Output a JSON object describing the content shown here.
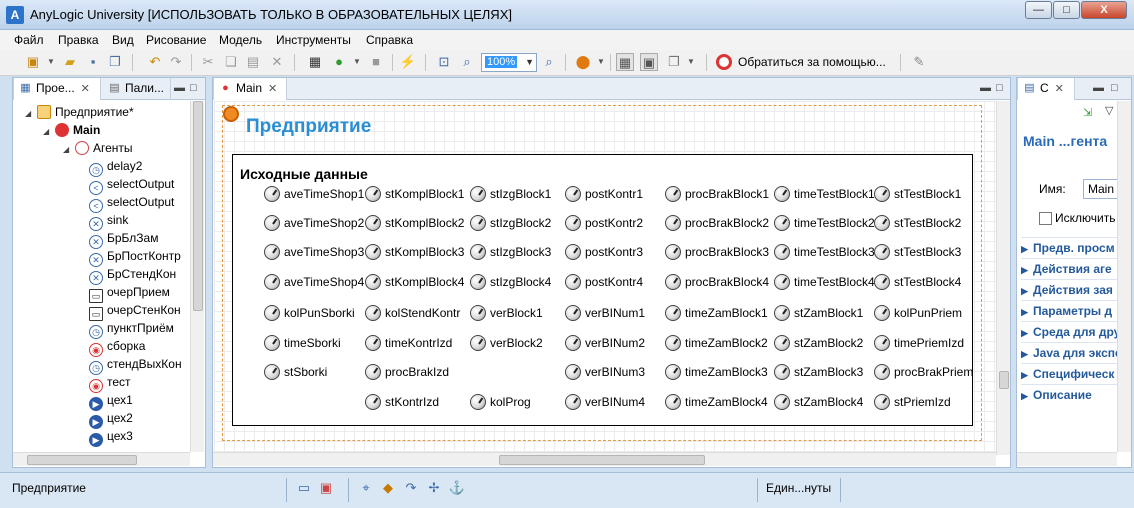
{
  "window": {
    "title": "AnyLogic University [ИСПОЛЬЗОВАТЬ ТОЛЬКО В ОБРАЗОВАТЕЛЬНЫХ ЦЕЛЯХ]",
    "app_icon": "A",
    "minimize": "—",
    "maximize": "□",
    "close": "X"
  },
  "menu": [
    "Файл",
    "Правка",
    "Вид",
    "Рисование",
    "Модель",
    "Инструменты",
    "Справка"
  ],
  "toolbar": {
    "zoom": "100%",
    "help_label": "Обратиться за помощью..."
  },
  "left_panel": {
    "tabs": [
      {
        "label": "Прое...",
        "icon": "project-icon",
        "close": "✕"
      },
      {
        "label": "Пали...",
        "icon": "palette-icon"
      }
    ],
    "tree": [
      {
        "label": "Предприятие*",
        "level": 0,
        "icon": "model-icon",
        "expander": "◢",
        "bold": false
      },
      {
        "label": "Main",
        "level": 1,
        "icon": "agent-icon",
        "expander": "◢",
        "bold": true
      },
      {
        "label": "Агенты",
        "level": 2,
        "icon": "agents-icon",
        "expander": "◢",
        "bold": false
      },
      {
        "label": "delay2",
        "level": 3,
        "icon": "delay-icon",
        "glyph": "◷"
      },
      {
        "label": "selectOutput",
        "level": 3,
        "icon": "select-output-icon",
        "glyph": "<"
      },
      {
        "label": "selectOutput",
        "level": 3,
        "icon": "select-output-icon",
        "glyph": "<"
      },
      {
        "label": "sink",
        "level": 3,
        "icon": "sink-icon",
        "glyph": "✕"
      },
      {
        "label": "БрБлЗам",
        "level": 3,
        "icon": "sink-icon",
        "glyph": "✕"
      },
      {
        "label": "БрПостКонтр",
        "level": 3,
        "icon": "sink-icon",
        "glyph": "✕"
      },
      {
        "label": "БрСтендКон",
        "level": 3,
        "icon": "sink-icon",
        "glyph": "✕"
      },
      {
        "label": "очерПрием",
        "level": 3,
        "icon": "queue-icon",
        "glyph": "▭"
      },
      {
        "label": "очерСтенКон",
        "level": 3,
        "icon": "queue-icon",
        "glyph": "▭"
      },
      {
        "label": "пунктПриём",
        "level": 3,
        "icon": "delay-icon",
        "glyph": "◷"
      },
      {
        "label": "сборка",
        "level": 3,
        "icon": "assembler-icon",
        "glyph": "◉"
      },
      {
        "label": "стендВыхКон",
        "level": 3,
        "icon": "delay-icon",
        "glyph": "◷"
      },
      {
        "label": "тест",
        "level": 3,
        "icon": "assembler-icon",
        "glyph": "◉"
      },
      {
        "label": "цех1",
        "level": 3,
        "icon": "source-icon",
        "glyph": "▶"
      },
      {
        "label": "цех2",
        "level": 3,
        "icon": "source-icon",
        "glyph": "▶"
      },
      {
        "label": "цех3",
        "level": 3,
        "icon": "source-icon",
        "glyph": "▶"
      }
    ]
  },
  "editor": {
    "tab": {
      "label": "Main",
      "close": "✕"
    },
    "canvas_title": "Предприятие",
    "data_box_title": "Исходные данные",
    "columns": [
      [
        "aveTimeShop1",
        "aveTimeShop2",
        "aveTimeShop3",
        "aveTimeShop4",
        "kolPunSborki",
        "timeSborki",
        "stSborki"
      ],
      [
        "stKomplBlock1",
        "stKomplBlock2",
        "stKomplBlock3",
        "stKomplBlock4",
        "kolStendKontr",
        "timeKontrIzd",
        "procBrakIzd",
        "stKontrIzd"
      ],
      [
        "stIzgBlock1",
        "stIzgBlock2",
        "stIzgBlock3",
        "stIzgBlock4",
        "verBlock1",
        "verBlock2",
        "",
        "kolProg"
      ],
      [
        "postKontr1",
        "postKontr2",
        "postKontr3",
        "postKontr4",
        "verBINum1",
        "verBINum2",
        "verBINum3",
        "verBINum4"
      ],
      [
        "procBrakBlock1",
        "procBrakBlock2",
        "procBrakBlock3",
        "procBrakBlock4",
        "timeZamBlock1",
        "timeZamBlock2",
        "timeZamBlock3",
        "timeZamBlock4"
      ],
      [
        "timeTestBlock1",
        "timeTestBlock2",
        "timeTestBlock3",
        "timeTestBlock4",
        "stZamBlock1",
        "stZamBlock2",
        "stZamBlock3",
        "stZamBlock4"
      ],
      [
        "stTestBlock1",
        "stTestBlock2",
        "stTestBlock3",
        "stTestBlock4",
        "kolPunPriem",
        "timePriemIzd",
        "procBrakPriem",
        "stPriemIzd"
      ]
    ]
  },
  "properties": {
    "tab": {
      "label": "С",
      "close": "✕"
    },
    "title": "Main ...гента",
    "name_label": "Имя:",
    "name_value": "Main",
    "exclude_label": "Исключить",
    "sections": [
      "Предв. просм",
      "Действия аге",
      "Действия зая",
      "Параметры д",
      "Среда для дру",
      "Java для экспе",
      "Специфическ",
      "Описание"
    ]
  },
  "status": {
    "left": "Предприятие",
    "units": "Един...нуты"
  }
}
